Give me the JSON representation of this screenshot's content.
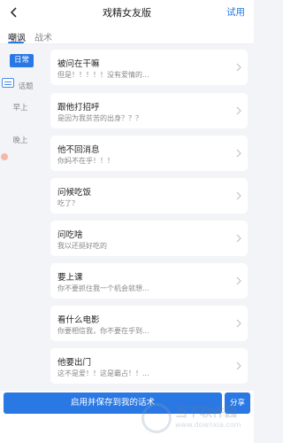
{
  "header": {
    "title": "戏精女友版",
    "trial_label": "试用"
  },
  "tabs": [
    {
      "label": "嘲讽",
      "active": true
    },
    {
      "label": "战术",
      "active": false
    }
  ],
  "sidebar": {
    "items": [
      {
        "label": "日常",
        "active": true
      },
      {
        "label": "话题",
        "active": false
      },
      {
        "label": "早上",
        "active": false
      },
      {
        "label": "晚上",
        "active": false
      }
    ]
  },
  "cards": [
    {
      "title": "被问在干嘛",
      "subtitle": "但是！！！！！没有爱情的..."
    },
    {
      "title": "跟他打招呼",
      "subtitle": "是因为我贫苦的出身？？？"
    },
    {
      "title": "他不回消息",
      "subtitle": "你妈不在乎！！！"
    },
    {
      "title": "问候吃饭",
      "subtitle": "吃了？"
    },
    {
      "title": "问吃啥",
      "subtitle": "我以还挺好吃的"
    },
    {
      "title": "要上课",
      "subtitle": "你不要抓住我一个机会就想..."
    },
    {
      "title": "看什么电影",
      "subtitle": "你要相信我，你不要在乎到..."
    },
    {
      "title": "他要出门",
      "subtitle": "这不是爱！！这是霸占！！..."
    }
  ],
  "footer": {
    "primary_label": "启用并保存到我的话术",
    "share_label": "分享"
  },
  "watermark": {
    "text": "当下软件园",
    "url": "www.downxia.com"
  },
  "colors": {
    "accent": "#2a78e4",
    "background": "#f3f4f7"
  },
  "icons": {
    "back": "chevron-left-icon",
    "card_arrow": "chevron-right-icon"
  }
}
